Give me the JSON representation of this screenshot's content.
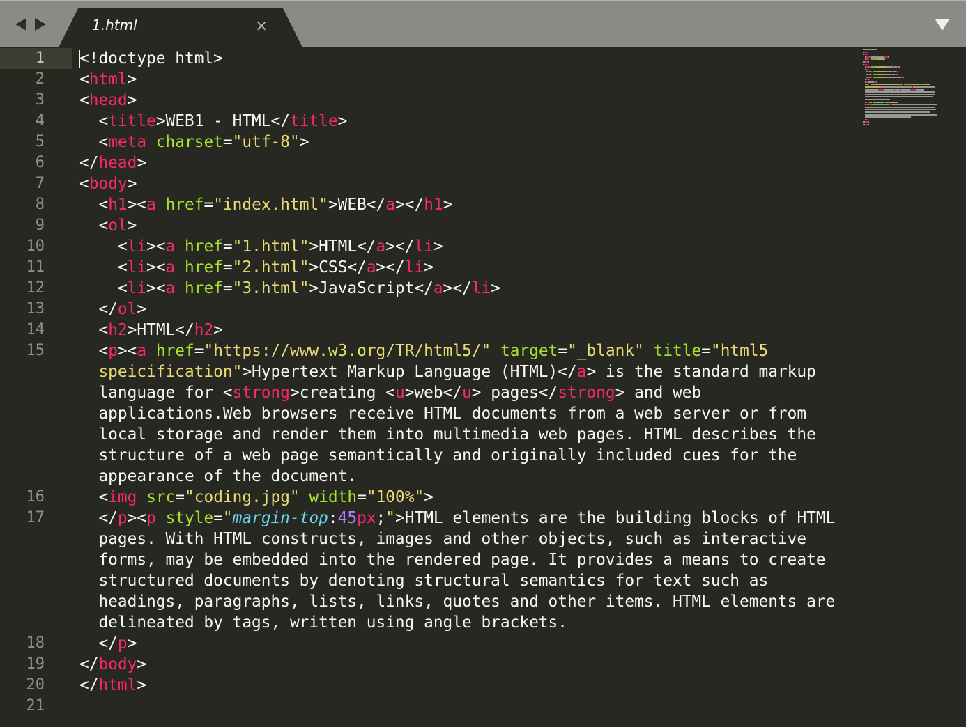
{
  "tab_bar": {
    "active_tab": {
      "label": "1.html",
      "close_glyph": "×"
    },
    "nav_icons": [
      "arrow-left-icon",
      "arrow-right-icon"
    ],
    "menu_icon": "chevron-down-icon"
  },
  "editor": {
    "current_line": 1,
    "colors": {
      "background": "#272822",
      "text": "#f8f8f2",
      "tag": "#f92672",
      "attribute": "#a6e22e",
      "string": "#e6db74",
      "css_property": "#66d9ef",
      "number": "#ae81ff",
      "gutter_text": "#90908a"
    },
    "lines": [
      {
        "number": "1",
        "segments": [
          [
            "t",
            "<!doctype html>"
          ]
        ]
      },
      {
        "number": "2",
        "segments": [
          [
            "t",
            "<"
          ],
          [
            "g",
            "html"
          ],
          [
            "t",
            ">"
          ]
        ]
      },
      {
        "number": "3",
        "segments": [
          [
            "t",
            "<"
          ],
          [
            "g",
            "head"
          ],
          [
            "t",
            ">"
          ]
        ]
      },
      {
        "number": "4",
        "segments": [
          [
            "t",
            "  <"
          ],
          [
            "g",
            "title"
          ],
          [
            "t",
            ">WEB1 - HTML</"
          ],
          [
            "g",
            "title"
          ],
          [
            "t",
            ">"
          ]
        ]
      },
      {
        "number": "5",
        "segments": [
          [
            "t",
            "  <"
          ],
          [
            "g",
            "meta"
          ],
          [
            "t",
            " "
          ],
          [
            "a",
            "charset"
          ],
          [
            "t",
            "="
          ],
          [
            "s",
            "\"utf-8\""
          ],
          [
            "t",
            ">"
          ]
        ]
      },
      {
        "number": "6",
        "segments": [
          [
            "t",
            "</"
          ],
          [
            "g",
            "head"
          ],
          [
            "t",
            ">"
          ]
        ]
      },
      {
        "number": "7",
        "segments": [
          [
            "t",
            "<"
          ],
          [
            "g",
            "body"
          ],
          [
            "t",
            ">"
          ]
        ]
      },
      {
        "number": "8",
        "segments": [
          [
            "t",
            "  <"
          ],
          [
            "g",
            "h1"
          ],
          [
            "t",
            "><"
          ],
          [
            "g",
            "a"
          ],
          [
            "t",
            " "
          ],
          [
            "a",
            "href"
          ],
          [
            "t",
            "="
          ],
          [
            "s",
            "\"index.html\""
          ],
          [
            "t",
            ">WEB</"
          ],
          [
            "g",
            "a"
          ],
          [
            "t",
            "></"
          ],
          [
            "g",
            "h1"
          ],
          [
            "t",
            ">"
          ]
        ]
      },
      {
        "number": "9",
        "segments": [
          [
            "t",
            "  <"
          ],
          [
            "g",
            "ol"
          ],
          [
            "t",
            ">"
          ]
        ]
      },
      {
        "number": "10",
        "segments": [
          [
            "t",
            "    <"
          ],
          [
            "g",
            "li"
          ],
          [
            "t",
            "><"
          ],
          [
            "g",
            "a"
          ],
          [
            "t",
            " "
          ],
          [
            "a",
            "href"
          ],
          [
            "t",
            "="
          ],
          [
            "s",
            "\"1.html\""
          ],
          [
            "t",
            ">HTML</"
          ],
          [
            "g",
            "a"
          ],
          [
            "t",
            "></"
          ],
          [
            "g",
            "li"
          ],
          [
            "t",
            ">"
          ]
        ]
      },
      {
        "number": "11",
        "segments": [
          [
            "t",
            "    <"
          ],
          [
            "g",
            "li"
          ],
          [
            "t",
            "><"
          ],
          [
            "g",
            "a"
          ],
          [
            "t",
            " "
          ],
          [
            "a",
            "href"
          ],
          [
            "t",
            "="
          ],
          [
            "s",
            "\"2.html\""
          ],
          [
            "t",
            ">CSS</"
          ],
          [
            "g",
            "a"
          ],
          [
            "t",
            "></"
          ],
          [
            "g",
            "li"
          ],
          [
            "t",
            ">"
          ]
        ]
      },
      {
        "number": "12",
        "segments": [
          [
            "t",
            "    <"
          ],
          [
            "g",
            "li"
          ],
          [
            "t",
            "><"
          ],
          [
            "g",
            "a"
          ],
          [
            "t",
            " "
          ],
          [
            "a",
            "href"
          ],
          [
            "t",
            "="
          ],
          [
            "s",
            "\"3.html\""
          ],
          [
            "t",
            ">JavaScript</"
          ],
          [
            "g",
            "a"
          ],
          [
            "t",
            "></"
          ],
          [
            "g",
            "li"
          ],
          [
            "t",
            ">"
          ]
        ]
      },
      {
        "number": "13",
        "segments": [
          [
            "t",
            "  </"
          ],
          [
            "g",
            "ol"
          ],
          [
            "t",
            ">"
          ]
        ]
      },
      {
        "number": "14",
        "segments": [
          [
            "t",
            "  <"
          ],
          [
            "g",
            "h2"
          ],
          [
            "t",
            ">HTML</"
          ],
          [
            "g",
            "h2"
          ],
          [
            "t",
            ">"
          ]
        ]
      },
      {
        "number": "15",
        "segments": [
          [
            "t",
            "  <"
          ],
          [
            "g",
            "p"
          ],
          [
            "t",
            "><"
          ],
          [
            "g",
            "a"
          ],
          [
            "t",
            " "
          ],
          [
            "a",
            "href"
          ],
          [
            "t",
            "="
          ],
          [
            "s",
            "\"https://www.w3.org/TR/html5/\""
          ],
          [
            "t",
            " "
          ],
          [
            "a",
            "target"
          ],
          [
            "t",
            "="
          ],
          [
            "s",
            "\"_blank\""
          ],
          [
            "t",
            " "
          ],
          [
            "a",
            "title"
          ],
          [
            "t",
            "="
          ],
          [
            "s",
            "\"html5"
          ]
        ]
      },
      {
        "number": "",
        "segments": [
          [
            "s",
            "  speicification\""
          ],
          [
            "t",
            ">Hypertext Markup Language (HTML)</"
          ],
          [
            "g",
            "a"
          ],
          [
            "t",
            "> is the standard markup"
          ]
        ]
      },
      {
        "number": "",
        "segments": [
          [
            "t",
            "  language for <"
          ],
          [
            "g",
            "strong"
          ],
          [
            "t",
            ">creating <"
          ],
          [
            "g",
            "u"
          ],
          [
            "t",
            ">web</"
          ],
          [
            "g",
            "u"
          ],
          [
            "t",
            "> pages</"
          ],
          [
            "g",
            "strong"
          ],
          [
            "t",
            "> and web"
          ]
        ]
      },
      {
        "number": "",
        "segments": [
          [
            "t",
            "  applications.Web browsers receive HTML documents from a web server or from"
          ]
        ]
      },
      {
        "number": "",
        "segments": [
          [
            "t",
            "  local storage and render them into multimedia web pages. HTML describes the"
          ]
        ]
      },
      {
        "number": "",
        "segments": [
          [
            "t",
            "  structure of a web page semantically and originally included cues for the"
          ]
        ]
      },
      {
        "number": "",
        "segments": [
          [
            "t",
            "  appearance of the document."
          ]
        ]
      },
      {
        "number": "16",
        "segments": [
          [
            "t",
            "  <"
          ],
          [
            "g",
            "img"
          ],
          [
            "t",
            " "
          ],
          [
            "a",
            "src"
          ],
          [
            "t",
            "="
          ],
          [
            "s",
            "\"coding.jpg\""
          ],
          [
            "t",
            " "
          ],
          [
            "a",
            "width"
          ],
          [
            "t",
            "="
          ],
          [
            "s",
            "\"100%\""
          ],
          [
            "t",
            ">"
          ]
        ]
      },
      {
        "number": "17",
        "segments": [
          [
            "t",
            "  </"
          ],
          [
            "g",
            "p"
          ],
          [
            "t",
            "><"
          ],
          [
            "g",
            "p"
          ],
          [
            "t",
            " "
          ],
          [
            "a",
            "style"
          ],
          [
            "t",
            "="
          ],
          [
            "s",
            "\""
          ],
          [
            "c",
            "margin-top"
          ],
          [
            "t",
            ":"
          ],
          [
            "n",
            "45"
          ],
          [
            "u",
            "px"
          ],
          [
            "t",
            ";"
          ],
          [
            "s",
            "\""
          ],
          [
            "t",
            ">HTML elements are the building blocks of HTML"
          ]
        ]
      },
      {
        "number": "",
        "segments": [
          [
            "t",
            "  pages. With HTML constructs, images and other objects, such as interactive"
          ]
        ]
      },
      {
        "number": "",
        "segments": [
          [
            "t",
            "  forms, may be embedded into the rendered page. It provides a means to create"
          ]
        ]
      },
      {
        "number": "",
        "segments": [
          [
            "t",
            "  structured documents by denoting structural semantics for text such as"
          ]
        ]
      },
      {
        "number": "",
        "segments": [
          [
            "t",
            "  headings, paragraphs, lists, links, quotes and other items. HTML elements are"
          ]
        ]
      },
      {
        "number": "",
        "segments": [
          [
            "t",
            "  delineated by tags, written using angle brackets."
          ]
        ]
      },
      {
        "number": "18",
        "segments": [
          [
            "t",
            "  </"
          ],
          [
            "g",
            "p"
          ],
          [
            "t",
            ">"
          ]
        ]
      },
      {
        "number": "19",
        "segments": [
          [
            "t",
            "</"
          ],
          [
            "g",
            "body"
          ],
          [
            "t",
            ">"
          ]
        ]
      },
      {
        "number": "20",
        "segments": [
          [
            "t",
            "</"
          ],
          [
            "g",
            "html"
          ],
          [
            "t",
            ">"
          ]
        ]
      },
      {
        "number": "21",
        "segments": []
      }
    ]
  }
}
